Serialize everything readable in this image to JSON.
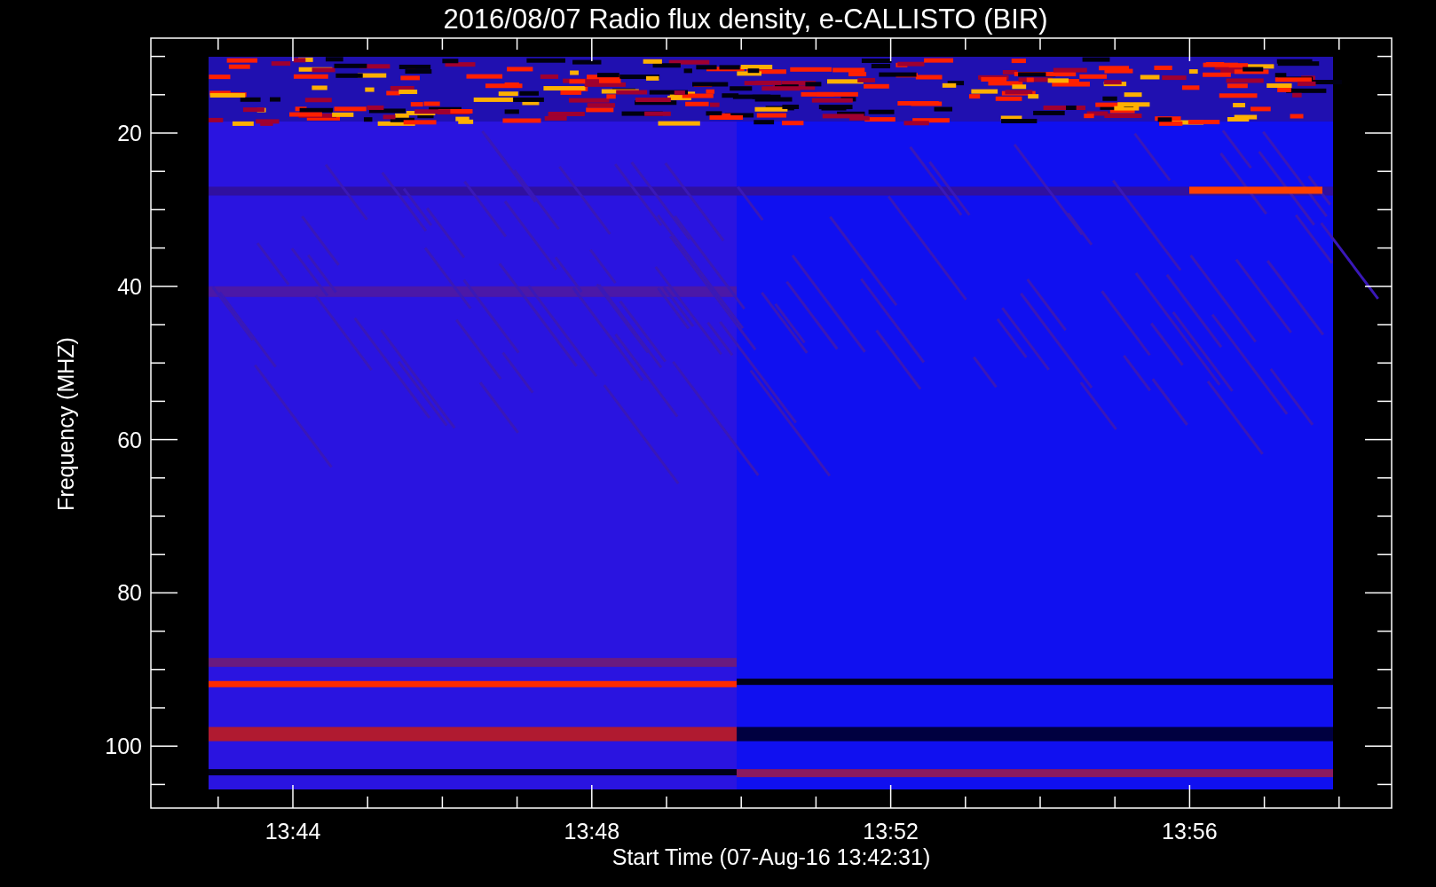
{
  "title": "2016/08/07  Radio flux density, e-CALLISTO (BIR)",
  "ylabel": "Frequency (MHZ)",
  "xlabel": "Start Time (07-Aug-16 13:42:31)",
  "yticks": [
    "20",
    "40",
    "60",
    "80",
    "100"
  ],
  "xticks": [
    "13:44",
    "13:48",
    "13:52",
    "13:56"
  ]
}
